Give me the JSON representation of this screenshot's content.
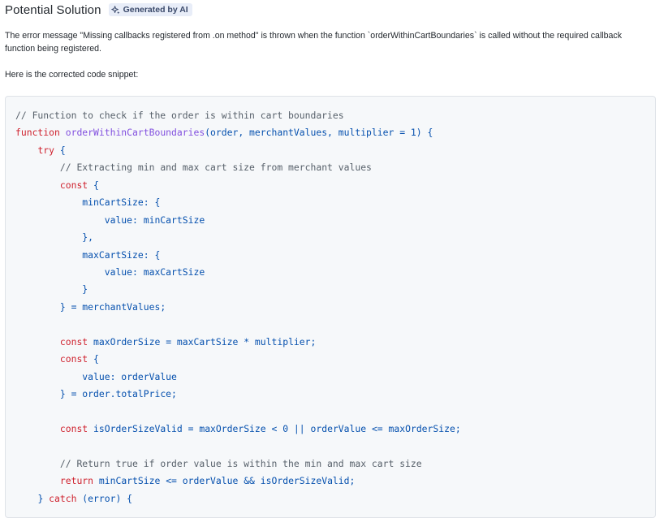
{
  "header": {
    "title": "Potential Solution",
    "badge_label": "Generated by AI",
    "badge_icon": "sparkle-icon"
  },
  "explanation": "The error message \"Missing callbacks registered from .on method\" is thrown when the function `orderWithinCartBoundaries` is called without the required callback function being registered.",
  "intro": "Here is the corrected code snippet:",
  "colors": {
    "comment": "#57606a",
    "keyword": "#cf222e",
    "function": "#8250df",
    "variable": "#0550ae",
    "operator": "#0550ae",
    "number": "#0550ae",
    "punct": "#24292f",
    "badge_bg": "#e8edf8",
    "code_bg": "#f6f8fa"
  },
  "code_lines": [
    [
      [
        "comment",
        "// Function to check if the order is within cart boundaries"
      ]
    ],
    [
      [
        "keyword",
        "function "
      ],
      [
        "function",
        "orderWithinCartBoundaries"
      ],
      [
        "variable",
        "(order, merchantValues, multiplier "
      ],
      [
        "operator",
        "="
      ],
      [
        "number",
        " 1"
      ],
      [
        "variable",
        ") {"
      ]
    ],
    [
      [
        "plain",
        "    "
      ],
      [
        "keyword",
        "try"
      ],
      [
        "variable",
        " {"
      ]
    ],
    [
      [
        "plain",
        "        "
      ],
      [
        "comment",
        "// Extracting min and max cart size from merchant values"
      ]
    ],
    [
      [
        "plain",
        "        "
      ],
      [
        "keyword",
        "const"
      ],
      [
        "variable",
        " {"
      ]
    ],
    [
      [
        "plain",
        "            "
      ],
      [
        "variable",
        "minCartSize: {"
      ]
    ],
    [
      [
        "plain",
        "                "
      ],
      [
        "variable",
        "value: minCartSize"
      ]
    ],
    [
      [
        "plain",
        "            "
      ],
      [
        "variable",
        "},"
      ]
    ],
    [
      [
        "plain",
        "            "
      ],
      [
        "variable",
        "maxCartSize: {"
      ]
    ],
    [
      [
        "plain",
        "                "
      ],
      [
        "variable",
        "value: maxCartSize"
      ]
    ],
    [
      [
        "plain",
        "            "
      ],
      [
        "variable",
        "}"
      ]
    ],
    [
      [
        "plain",
        "        "
      ],
      [
        "variable",
        "} "
      ],
      [
        "operator",
        "="
      ],
      [
        "variable",
        " merchantValues;"
      ]
    ],
    [
      [
        "plain",
        ""
      ]
    ],
    [
      [
        "plain",
        "        "
      ],
      [
        "keyword",
        "const"
      ],
      [
        "variable",
        " maxOrderSize "
      ],
      [
        "operator",
        "="
      ],
      [
        "variable",
        " maxCartSize "
      ],
      [
        "operator",
        "*"
      ],
      [
        "variable",
        " multiplier;"
      ]
    ],
    [
      [
        "plain",
        "        "
      ],
      [
        "keyword",
        "const"
      ],
      [
        "variable",
        " {"
      ]
    ],
    [
      [
        "plain",
        "            "
      ],
      [
        "variable",
        "value: orderValue"
      ]
    ],
    [
      [
        "plain",
        "        "
      ],
      [
        "variable",
        "} "
      ],
      [
        "operator",
        "="
      ],
      [
        "variable",
        " order.totalPrice;"
      ]
    ],
    [
      [
        "plain",
        ""
      ]
    ],
    [
      [
        "plain",
        "        "
      ],
      [
        "keyword",
        "const"
      ],
      [
        "variable",
        " isOrderSizeValid "
      ],
      [
        "operator",
        "="
      ],
      [
        "variable",
        " maxOrderSize "
      ],
      [
        "operator",
        "<"
      ],
      [
        "number",
        " 0"
      ],
      [
        "operator",
        " ||"
      ],
      [
        "variable",
        " orderValue "
      ],
      [
        "operator",
        "<="
      ],
      [
        "variable",
        " maxOrderSize;"
      ]
    ],
    [
      [
        "plain",
        ""
      ]
    ],
    [
      [
        "plain",
        "        "
      ],
      [
        "comment",
        "// Return true if order value is within the min and max cart size"
      ]
    ],
    [
      [
        "plain",
        "        "
      ],
      [
        "keyword",
        "return"
      ],
      [
        "variable",
        " minCartSize "
      ],
      [
        "operator",
        "<="
      ],
      [
        "variable",
        " orderValue "
      ],
      [
        "operator",
        "&&"
      ],
      [
        "variable",
        " isOrderSizeValid;"
      ]
    ],
    [
      [
        "plain",
        "    "
      ],
      [
        "variable",
        "} "
      ],
      [
        "keyword",
        "catch"
      ],
      [
        "variable",
        " (error) {"
      ]
    ]
  ]
}
